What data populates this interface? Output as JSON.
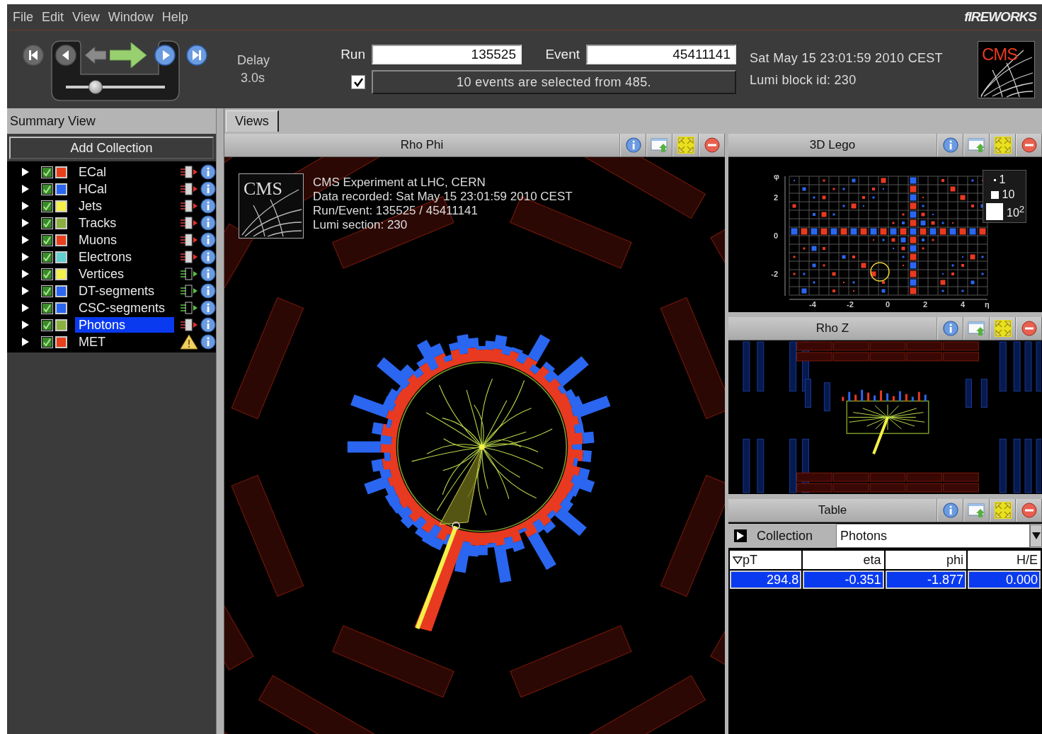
{
  "menu": [
    {
      "label": "File"
    },
    {
      "label": "Edit"
    },
    {
      "label": "View"
    },
    {
      "label": "Window"
    },
    {
      "label": "Help"
    }
  ],
  "app_logo": "fIREWORKS",
  "player": {
    "delay_label": "Delay",
    "delay_value": "3.0s",
    "level": 0.3
  },
  "run": {
    "label": "Run",
    "value": "135525"
  },
  "event": {
    "label": "Event",
    "value": "45411141"
  },
  "filter": {
    "checked": true,
    "message": "10 events are selected from 485."
  },
  "event_time": "Sat May 15 23:01:59 2010 CEST",
  "lumi_block": "Lumi block id: 230",
  "experiment_logo": "CMS",
  "sidebar": {
    "title": "Summary View",
    "add_button": "Add Collection",
    "collections": [
      {
        "name": "ECal",
        "visible": true,
        "color": "#e8401c",
        "kind": "standard",
        "selected": false
      },
      {
        "name": "HCal",
        "visible": true,
        "color": "#2a66f0",
        "kind": "standard",
        "selected": false
      },
      {
        "name": "Jets",
        "visible": true,
        "color": "#f4f048",
        "kind": "standard",
        "selected": false
      },
      {
        "name": "Tracks",
        "visible": true,
        "color": "#8cb040",
        "kind": "standard",
        "selected": false
      },
      {
        "name": "Muons",
        "visible": true,
        "color": "#e8401c",
        "kind": "standard",
        "selected": false
      },
      {
        "name": "Electrons",
        "visible": true,
        "color": "#60d0d0",
        "kind": "standard",
        "selected": false
      },
      {
        "name": "Vertices",
        "visible": true,
        "color": "#f4f048",
        "kind": "secondary",
        "selected": false
      },
      {
        "name": "DT-segments",
        "visible": true,
        "color": "#2a66f0",
        "kind": "secondary",
        "selected": false
      },
      {
        "name": "CSC-segments",
        "visible": true,
        "color": "#2a66f0",
        "kind": "secondary",
        "selected": false
      },
      {
        "name": "Photons",
        "visible": true,
        "color": "#8cb040",
        "kind": "standard",
        "selected": true
      },
      {
        "name": "MET",
        "visible": true,
        "color": "#e8401c",
        "kind": "warning",
        "selected": false
      }
    ]
  },
  "views": {
    "tab": "Views",
    "rho_phi": {
      "title": "Rho Phi",
      "logo": "CMS",
      "info_lines": [
        "CMS Experiment at LHC, CERN",
        "Data recorded: Sat May 15 23:01:59 2010 CEST",
        "Run/Event: 135525 / 45411141",
        "Lumi section: 230"
      ]
    },
    "lego": {
      "title": "3D Lego",
      "y_label": "φ",
      "y_ticks": [
        "2",
        "0",
        "-2"
      ],
      "x_ticks": [
        "-4",
        "-2",
        "0",
        "2",
        "4"
      ],
      "x_label": "η",
      "legend": [
        "1",
        "10",
        "10$^{2}$"
      ]
    },
    "rho_z": {
      "title": "Rho Z"
    },
    "table": {
      "title": "Table",
      "collection_label": "Collection",
      "collection": "Photons",
      "columns": [
        {
          "label": "pT",
          "sorted": true
        },
        {
          "label": "eta",
          "sorted": false
        },
        {
          "label": "phi",
          "sorted": false
        },
        {
          "label": "H/E",
          "sorted": false
        }
      ],
      "rows": [
        {
          "selected": true,
          "cells": [
            "294.8",
            "-0.351",
            "-1.877",
            "0.000"
          ]
        }
      ]
    }
  }
}
